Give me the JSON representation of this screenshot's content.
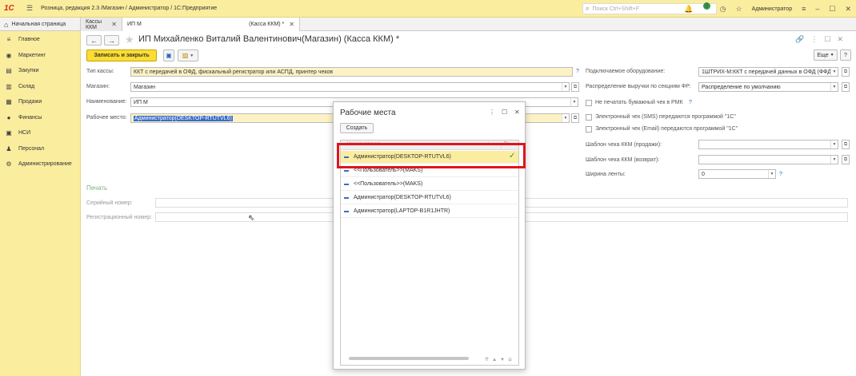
{
  "app": {
    "title": "Розница, редакция 2.3 /Магазин / Администратор / 1С:Предприятие",
    "logo_text": "1С",
    "search_placeholder": "Поиск Ctrl+Shift+F",
    "notifications_count": "9",
    "user": "Администратор"
  },
  "tabs": {
    "home": "Начальная страница",
    "kassy": "Кассы ККМ",
    "active_left": "ИП М",
    "active_right": "(Касса ККМ) *"
  },
  "sidebar": {
    "items": [
      {
        "label": "Главное",
        "icon": "≡"
      },
      {
        "label": "Маркетинг",
        "icon": "◉"
      },
      {
        "label": "Закупки",
        "icon": "▤"
      },
      {
        "label": "Склад",
        "icon": "▥"
      },
      {
        "label": "Продажи",
        "icon": "▦"
      },
      {
        "label": "Финансы",
        "icon": "●"
      },
      {
        "label": "НСИ",
        "icon": "▣"
      },
      {
        "label": "Персонал",
        "icon": "♟"
      },
      {
        "label": "Администрирование",
        "icon": "⚙"
      }
    ]
  },
  "form": {
    "title": "ИП Михайленко Виталий Валентинович(Магазин) (Касса ККМ) *",
    "save_close": "Записать и закрыть",
    "more": "Еще",
    "help": "?",
    "fields": {
      "type_label": "Тип кассы:",
      "type_value": "ККТ с передачей в ОФД, фискальный регистратор или АСПД, принтер чеков",
      "store_label": "Магазин:",
      "store_value": "Магазин",
      "name_label": "Наименование:",
      "name_value": "ИП М",
      "workplace_label": "Рабочее место:",
      "workplace_value": "Администратор(DESKTOP-RTUTVL6)",
      "equipment_label": "Подключаемое оборудование:",
      "equipment_value": "1ШТРИХ-М:ККТ с передачей данных в ОФД (ФФД)",
      "distribution_label": "Распределение выручки по секциям ФР:",
      "distribution_value": "Распределение по умолчанию",
      "no_print_label": "Не печатать бумажный чек в РМК",
      "sms_label": "Электронный чек (SMS) передаются программой \"1С\"",
      "email_label": "Электронный чек (Email) передаются программой \"1С\"",
      "template_sale_label": "Шаблон чека ККМ (продажи):",
      "template_return_label": "Шаблон чека ККМ (возврат):",
      "tape_width_label": "Ширина ленты:",
      "tape_width_value": "0",
      "print_section": "Печать",
      "serial_label": "Серийный номер:",
      "reg_label": "Регистрационный номер:"
    }
  },
  "dialog": {
    "title": "Рабочие места",
    "create": "Создать",
    "col_name": "Наименование",
    "col2": "Те...",
    "rows": [
      {
        "label": "Администратор(DESKTOP-RTUTVL6)",
        "selected": true,
        "checked": true
      },
      {
        "label": "<<Пользователь>>(MAKS)",
        "selected": false,
        "checked": false
      },
      {
        "label": "<<Пользователь>>(MAKS)",
        "selected": false,
        "checked": false
      },
      {
        "label": "Администратор(DESKTOP-RTUTVL6)",
        "selected": false,
        "checked": false
      },
      {
        "label": "Администратор(LAPTOP-B1R1JHTR)",
        "selected": false,
        "checked": false
      }
    ]
  }
}
